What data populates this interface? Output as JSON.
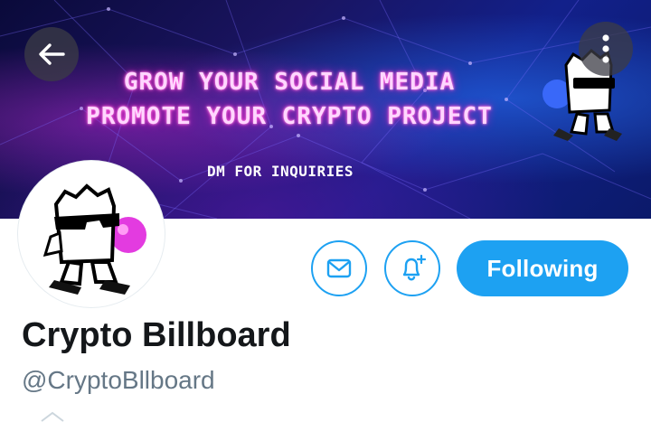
{
  "banner": {
    "headline_line1": "GROW YOUR SOCIAL MEDIA",
    "headline_line2": "PROMOTE YOUR CRYPTO PROJECT",
    "subline": "DM FOR INQUIRIES"
  },
  "nav": {
    "back_icon": "arrow-left-icon",
    "more_icon": "more-vertical-icon"
  },
  "actions": {
    "message_icon": "envelope-icon",
    "notify_icon": "bell-plus-icon",
    "follow_label": "Following"
  },
  "profile": {
    "name": "Crypto Billboard",
    "handle": "@CryptoBllboard"
  },
  "colors": {
    "accent": "#1da1f2",
    "name_text": "#14171a",
    "handle_text": "#657786",
    "neon_pink": "#ff4ddb"
  }
}
